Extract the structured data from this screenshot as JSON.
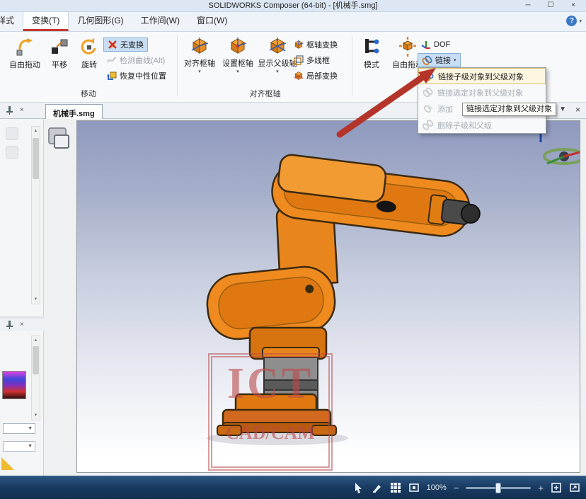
{
  "window": {
    "title": "SOLIDWORKS Composer (64-bit) - [机械手.smg]",
    "minimize": "─",
    "maximize": "☐",
    "close": "×"
  },
  "menubar": {
    "tabs": [
      {
        "label": "样式"
      },
      {
        "label": "变换(T)"
      },
      {
        "label": "几何图形(G)"
      },
      {
        "label": "工作间(W)"
      },
      {
        "label": "窗口(W)"
      }
    ],
    "help": "?"
  },
  "ribbon": {
    "move_group": {
      "label": "移动",
      "buttons": [
        {
          "label": "自由拖动"
        },
        {
          "label": "平移"
        },
        {
          "label": "旋转"
        }
      ],
      "options": [
        {
          "label": "无变换"
        },
        {
          "label": "检测曲线(Alt)"
        },
        {
          "label": "恢复中性位置"
        }
      ]
    },
    "pivot_group": {
      "label": "对齐枢轴",
      "buttons": [
        {
          "label": "对齐枢轴"
        },
        {
          "label": "设置枢轴"
        },
        {
          "label": "显示父级轴"
        }
      ],
      "options": [
        {
          "label": "枢轴变换"
        },
        {
          "label": "多线框"
        },
        {
          "label": "局部变换"
        }
      ]
    },
    "assembly_group": {
      "buttons": [
        {
          "label": "模式"
        },
        {
          "label": "自由拖动"
        }
      ],
      "options": [
        {
          "label": "DOF"
        },
        {
          "label": "链接"
        }
      ]
    }
  },
  "dropdown": {
    "items": [
      {
        "label": "链接子级对象到父级对象",
        "enabled": true
      },
      {
        "label": "链接选定对象到父级对象",
        "enabled": false
      },
      {
        "label": "添加",
        "enabled": false
      },
      {
        "label": "删除子级和父级",
        "enabled": false
      }
    ]
  },
  "tooltip": {
    "text": "链接选定对象到父级对象"
  },
  "docbar": {
    "tab": "机械手.smg"
  },
  "viewport": {
    "watermark_line1": "ICT",
    "watermark_line2": "CAD/CAM"
  },
  "statusbar": {
    "zoom": "100%",
    "minus": "−",
    "plus": "+"
  },
  "icons": {
    "chevron_down": "▾",
    "close": "×",
    "scroll_up": "▲",
    "scroll_down": "▼",
    "combo_down": "▼"
  }
}
